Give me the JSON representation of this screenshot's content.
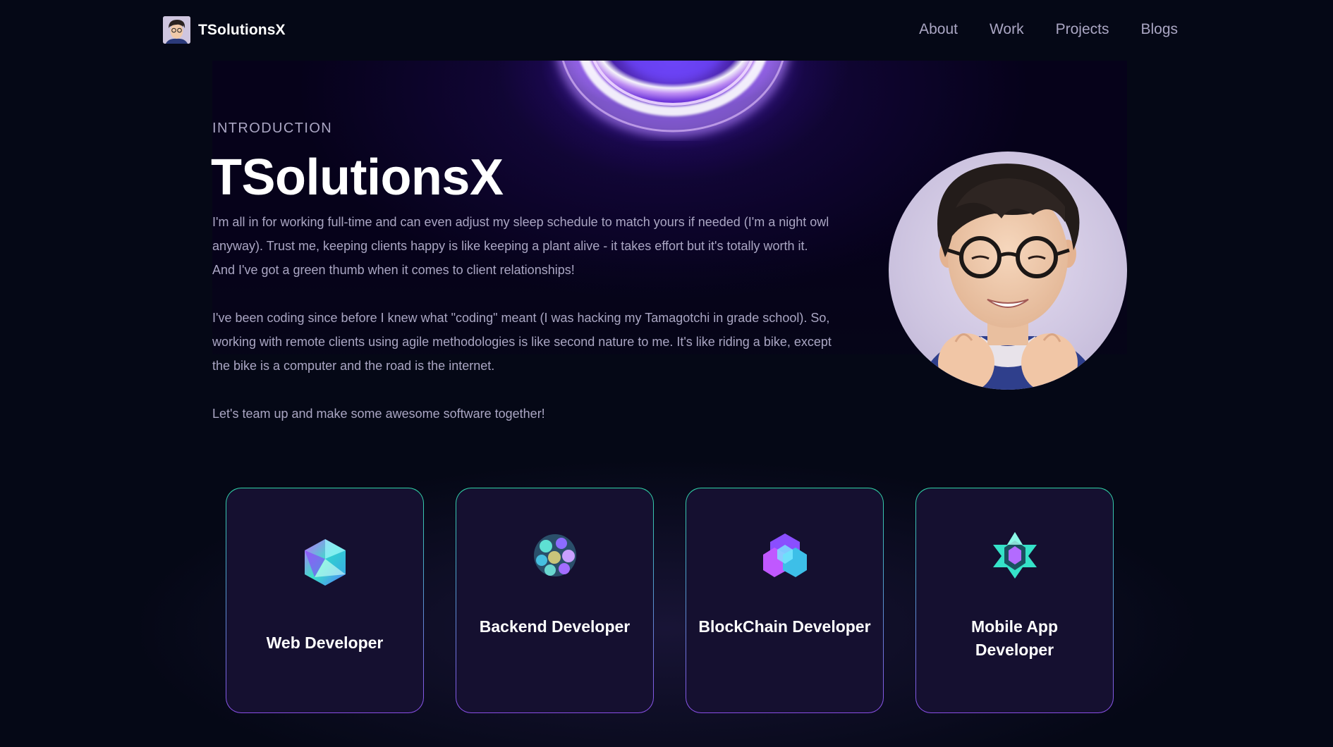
{
  "nav": {
    "brand": "TSolutionsX",
    "links": [
      {
        "label": "About"
      },
      {
        "label": "Work"
      },
      {
        "label": "Projects"
      },
      {
        "label": "Blogs"
      }
    ]
  },
  "hero": {
    "intro_label": "INTRODUCTION",
    "title": "TSolutionsX",
    "bio": [
      "I'm all in for working full-time and can even adjust my sleep schedule to match yours if needed (I'm a night owl anyway). Trust me, keeping clients happy is like keeping a plant alive - it takes effort but it's totally worth it. And I've got a green thumb when it comes to client relationships!",
      "I've been coding since before I knew what \"coding\" meant (I was hacking my Tamagotchi in grade school). So, working with remote clients using agile methodologies is like second nature to me. It's like riding a bike, except the bike is a computer and the road is the internet.",
      "Let's team up and make some awesome software together!"
    ]
  },
  "services": [
    {
      "title": "Web Developer",
      "icon": "icosahedron-icon"
    },
    {
      "title": "Backend Developer",
      "icon": "sphere-cluster-icon"
    },
    {
      "title": "BlockChain Developer",
      "icon": "hexagon-cluster-icon"
    },
    {
      "title": "Mobile App Developer",
      "icon": "cube-star-icon"
    }
  ],
  "colors": {
    "background": "#050816",
    "secondary_text": "#aaa6c3",
    "card_bg": "#151030",
    "card_border_top": "#2fd3a5",
    "card_border_bottom": "#8a4ee8",
    "glow": "#7b4dff"
  }
}
